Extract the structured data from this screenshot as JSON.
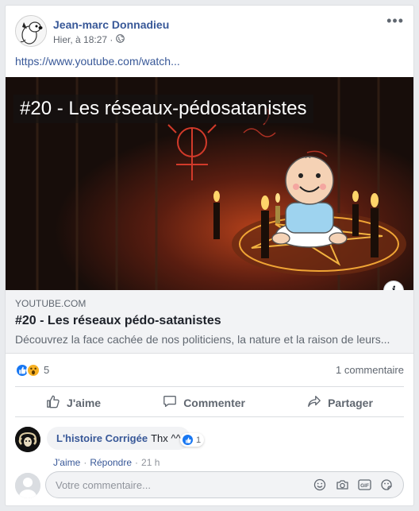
{
  "post": {
    "author": "Jean-marc Donnadieu",
    "time": "Hier, à 18:27 ·",
    "more_label": "•••",
    "link_text": "https://www.youtube.com/watch..."
  },
  "preview": {
    "overlay_title": "#20 - Les réseaux-pédosatanistes",
    "info_label": "i",
    "domain": "YOUTUBE.COM",
    "title": "#20 - Les réseaux pédo-satanistes",
    "description": "Découvrez la face cachée de nos politiciens, la nature et la raison de leurs..."
  },
  "stats": {
    "reaction_count": "5",
    "comment_count": "1 commentaire"
  },
  "actions": {
    "like": "J'aime",
    "comment": "Commenter",
    "share": "Partager"
  },
  "comment": {
    "author": "L'histoire Corrigée",
    "text": "Thx ^^",
    "like_count": "1",
    "like_link": "J'aime",
    "reply_link": "Répondre",
    "time": "21 h"
  },
  "composer": {
    "placeholder": "Votre commentaire..."
  },
  "colors": {
    "link": "#385898",
    "like_blue": "#1877f2",
    "wow_yellow": "#f7b125"
  },
  "icons": [
    "globe-icon",
    "more-icon",
    "info-icon",
    "like-reaction-icon",
    "wow-reaction-icon",
    "thumb-up-icon",
    "comment-icon",
    "share-icon",
    "emoji-icon",
    "camera-icon",
    "gif-icon",
    "sticker-icon"
  ]
}
